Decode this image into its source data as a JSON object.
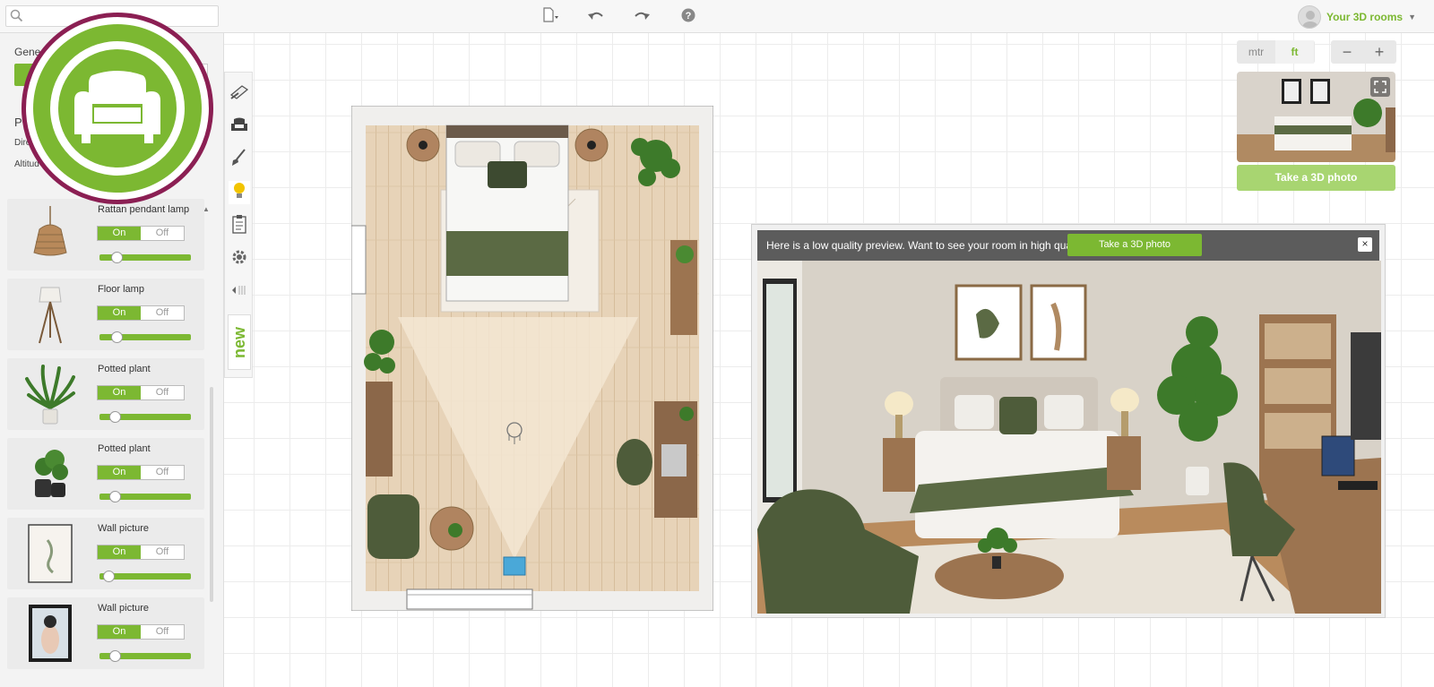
{
  "topbar": {
    "search_placeholder": "",
    "user_label": "Your 3D rooms",
    "icons": [
      "new-file-icon",
      "undo-icon",
      "redo-icon",
      "help-icon"
    ]
  },
  "left_panel": {
    "general_label": "Gene",
    "section_p_label": "P",
    "direction_label": "Dire",
    "altitude_label": "Altitud",
    "items": [
      {
        "name": "Rattan pendant lamp",
        "on": "On",
        "off": "Off",
        "state": "on",
        "level": 0.15
      },
      {
        "name": "Floor lamp",
        "on": "On",
        "off": "Off",
        "state": "on",
        "level": 0.15
      },
      {
        "name": "Potted plant",
        "on": "On",
        "off": "Off",
        "state": "on",
        "level": 0.12
      },
      {
        "name": "Potted plant",
        "on": "On",
        "off": "Off",
        "state": "on",
        "level": 0.12
      },
      {
        "name": "Wall picture",
        "on": "On",
        "off": "Off",
        "state": "on",
        "level": 0.05
      },
      {
        "name": "Wall picture",
        "on": "On",
        "off": "Off",
        "state": "on",
        "level": 0.12
      }
    ]
  },
  "tools": {
    "new_badge": "new",
    "icons": [
      "paint-roller-icon",
      "armchair-icon",
      "brush-icon",
      "lightbulb-icon",
      "clipboard-icon",
      "gear-icon",
      "collapse-icon"
    ]
  },
  "view_controls": {
    "unit_mtr": "mtr",
    "unit_ft": "ft",
    "zoom_out": "−",
    "zoom_in": "+",
    "take_3d_photo": "Take a 3D photo"
  },
  "preview": {
    "message": "Here is a low quality preview. Want to see your room in high quality?",
    "button": "Take a 3D photo",
    "close": "×"
  },
  "colors": {
    "accent": "#7cb832",
    "logo_ring": "#8b1f53"
  }
}
